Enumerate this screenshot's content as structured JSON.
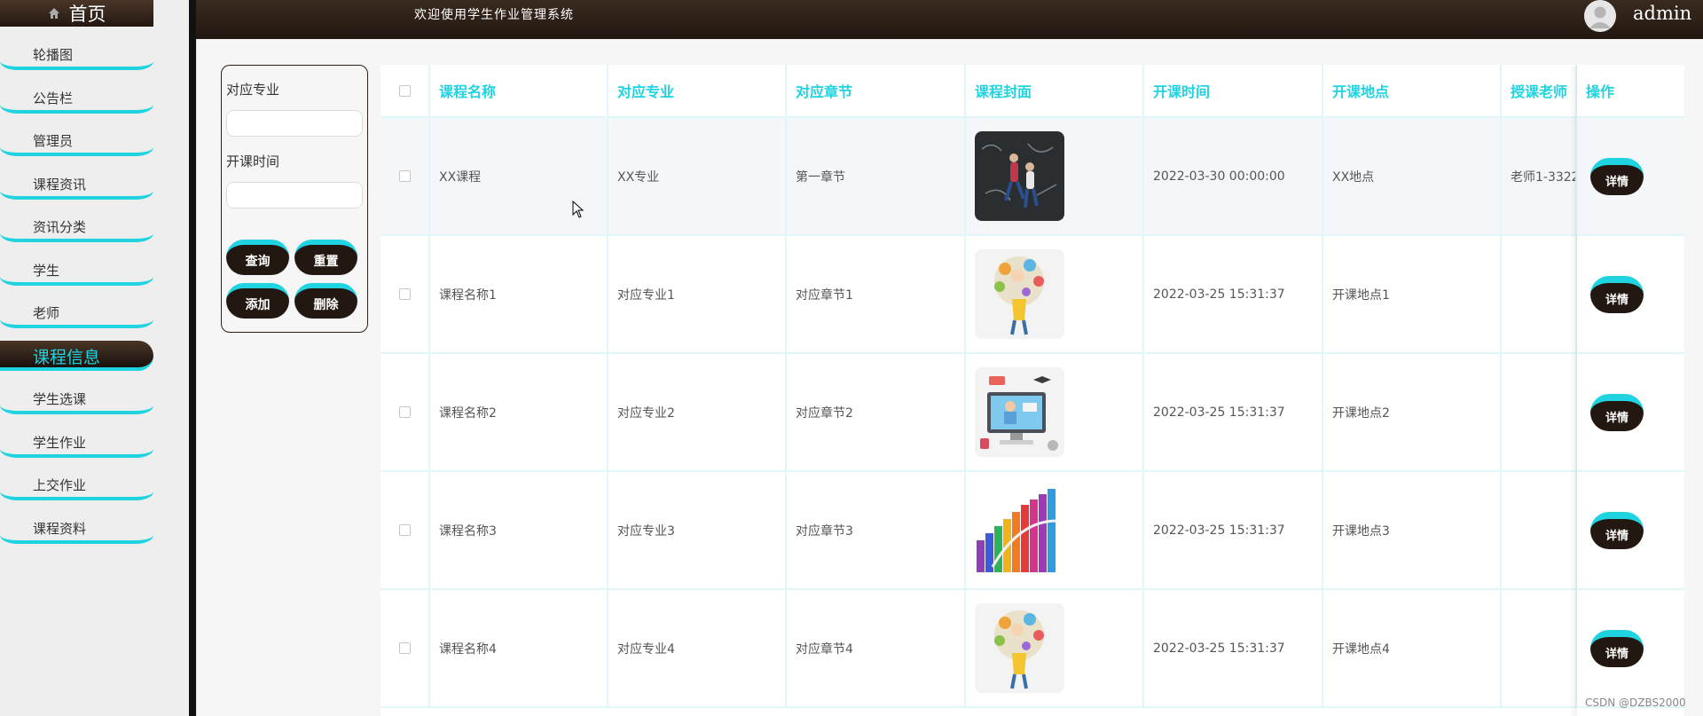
{
  "sidebar": {
    "home_label": "首页",
    "items": [
      {
        "label": "轮播图"
      },
      {
        "label": "公告栏"
      },
      {
        "label": "管理员"
      },
      {
        "label": "课程资讯"
      },
      {
        "label": "资讯分类"
      },
      {
        "label": "学生"
      },
      {
        "label": "老师"
      },
      {
        "label": "课程信息",
        "active": true
      },
      {
        "label": "学生选课"
      },
      {
        "label": "学生作业"
      },
      {
        "label": "上交作业"
      },
      {
        "label": "课程资料"
      }
    ]
  },
  "topbar": {
    "title": "欢迎使用学生作业管理系统",
    "user": "admin"
  },
  "search": {
    "major_label": "对应专业",
    "major_value": "",
    "time_label": "开课时间",
    "time_value": "",
    "query_label": "查询",
    "reset_label": "重置",
    "add_label": "添加",
    "delete_label": "删除"
  },
  "table": {
    "headers": [
      "课程名称",
      "对应专业",
      "对应章节",
      "课程封面",
      "开课时间",
      "开课地点",
      "授课老师",
      "操作"
    ],
    "detail_label": "详情",
    "rows": [
      {
        "name": "XX课程",
        "major": "XX专业",
        "chapter": "第一章节",
        "cover": "chalkboard-photo",
        "time": "2022-03-30 00:00:00",
        "place": "XX地点",
        "teacher": "老师1-3322"
      },
      {
        "name": "课程名称1",
        "major": "对应专业1",
        "chapter": "对应章节1",
        "cover": "thinking-boy-illustration",
        "time": "2022-03-25 15:31:37",
        "place": "开课地点1",
        "teacher": ""
      },
      {
        "name": "课程名称2",
        "major": "对应专业2",
        "chapter": "对应章节2",
        "cover": "online-class-illustration",
        "time": "2022-03-25 15:31:37",
        "place": "开课地点2",
        "teacher": ""
      },
      {
        "name": "课程名称3",
        "major": "对应专业3",
        "chapter": "对应章节3",
        "cover": "colored-pencils-illustration",
        "time": "2022-03-25 15:31:37",
        "place": "开课地点3",
        "teacher": ""
      },
      {
        "name": "课程名称4",
        "major": "对应专业4",
        "chapter": "对应章节4",
        "cover": "thinking-boy-illustration",
        "time": "2022-03-25 15:31:37",
        "place": "开课地点4",
        "teacher": ""
      }
    ]
  },
  "watermark": "CSDN @DZBS2000",
  "colors": {
    "accent": "#1fd3e0",
    "dark": "#231811"
  }
}
